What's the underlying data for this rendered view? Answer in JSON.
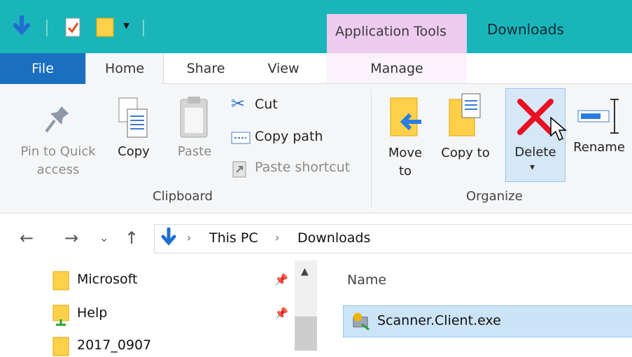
{
  "title_bar": {
    "context_tab_label": "Application Tools",
    "window_title": "Downloads"
  },
  "tabs": [
    {
      "label": "File"
    },
    {
      "label": "Home"
    },
    {
      "label": "Share"
    },
    {
      "label": "View"
    },
    {
      "label": "Manage"
    }
  ],
  "ribbon": {
    "pin_label": "Pin to Quick access",
    "copy_label": "Copy",
    "paste_label": "Paste",
    "cut_label": "Cut",
    "copy_path_label": "Copy path",
    "paste_shortcut_label": "Paste shortcut",
    "clipboard_group": "Clipboard",
    "move_to_label": "Move to",
    "copy_to_label": "Copy to",
    "delete_label": "Delete",
    "rename_label": "Rename",
    "organize_group": "Organize"
  },
  "address": {
    "crumbs": [
      "This PC",
      "Downloads"
    ]
  },
  "nav_pane": {
    "items": [
      {
        "label": "Microsoft",
        "icon": "folder-icon",
        "pinned": true
      },
      {
        "label": "Help",
        "icon": "folder-green-icon",
        "pinned": true
      },
      {
        "label": "2017_0907",
        "icon": "folder-icon",
        "pinned": false
      }
    ]
  },
  "file_list": {
    "column_name": "Name",
    "files": [
      {
        "name": "Scanner.Client.exe",
        "icon": "exe-icon",
        "selected": true
      }
    ]
  },
  "colors": {
    "title_bar": "#1ab5b9",
    "file_tab": "#1a6fbf",
    "context_tab": "#eecbf0",
    "selection": "#cce4f7",
    "delete_red": "#e81123"
  }
}
